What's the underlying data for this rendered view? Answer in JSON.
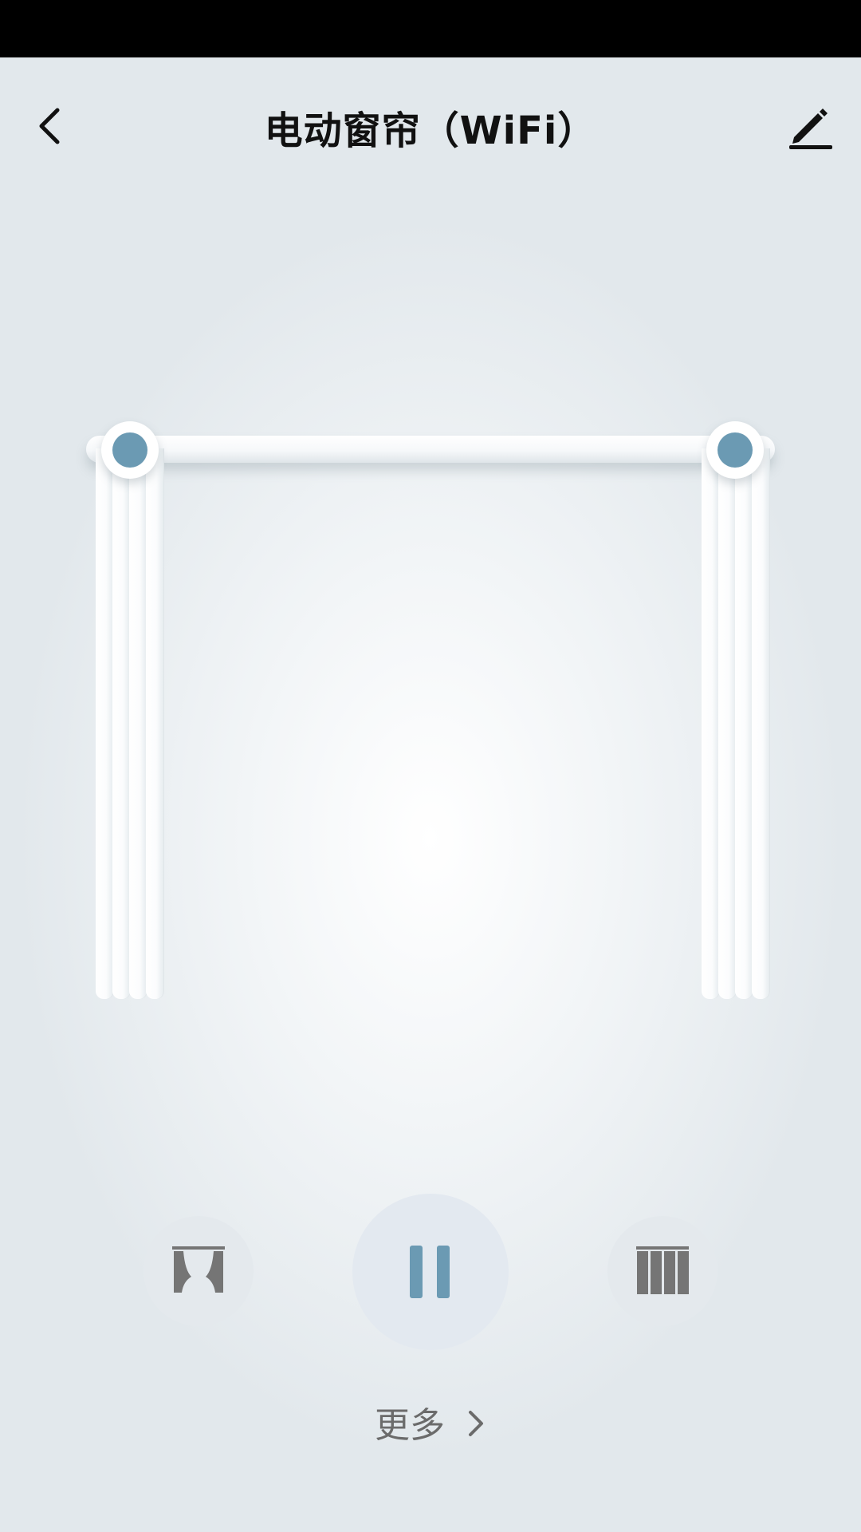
{
  "header": {
    "title": "电动窗帘（WiFi）",
    "back_icon": "chevron-left-icon",
    "edit_icon": "pencil-icon"
  },
  "curtain": {
    "state": "open",
    "left_handle_icon": "handle-dot-icon",
    "right_handle_icon": "handle-dot-icon",
    "accent_color": "#6b9ab3"
  },
  "controls": {
    "open_icon": "curtain-open-icon",
    "pause_icon": "pause-icon",
    "close_icon": "curtain-close-icon",
    "icon_color": "#757575",
    "pause_color": "#6b9ab3"
  },
  "footer": {
    "more_label": "更多",
    "more_icon": "chevron-right-icon"
  }
}
